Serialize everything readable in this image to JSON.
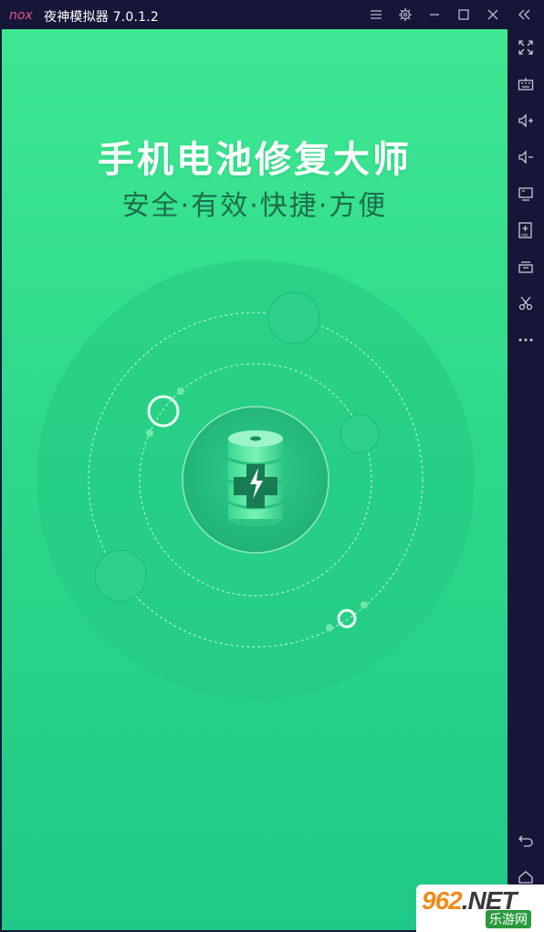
{
  "titlebar": {
    "logo_text": "nox",
    "app_title": "夜神模拟器 7.0.1.2",
    "buttons": [
      {
        "name": "menu-icon"
      },
      {
        "name": "gear-icon"
      },
      {
        "name": "minimize-icon"
      },
      {
        "name": "maximize-icon"
      },
      {
        "name": "close-icon"
      },
      {
        "name": "collapse-sidebar-icon"
      }
    ]
  },
  "sidebar": {
    "items": [
      {
        "name": "fullscreen-icon"
      },
      {
        "name": "keyboard-icon"
      },
      {
        "name": "volume-up-icon"
      },
      {
        "name": "volume-down-icon"
      },
      {
        "name": "screen-icon"
      },
      {
        "name": "apk-install-icon"
      },
      {
        "name": "multi-instance-icon"
      },
      {
        "name": "scissors-icon"
      },
      {
        "name": "more-icon"
      },
      {
        "name": "back-icon"
      },
      {
        "name": "home-icon"
      }
    ]
  },
  "app": {
    "headline": "手机电池修复大师",
    "subline": "安全·有效·快捷·方便"
  },
  "watermark": {
    "main": "962",
    "net": ".NET",
    "sub": "乐游网"
  },
  "colors": {
    "screen_top": "#3ee892",
    "screen_bottom": "#20c987",
    "subline": "#1e6d4c",
    "frame": "#161638"
  }
}
